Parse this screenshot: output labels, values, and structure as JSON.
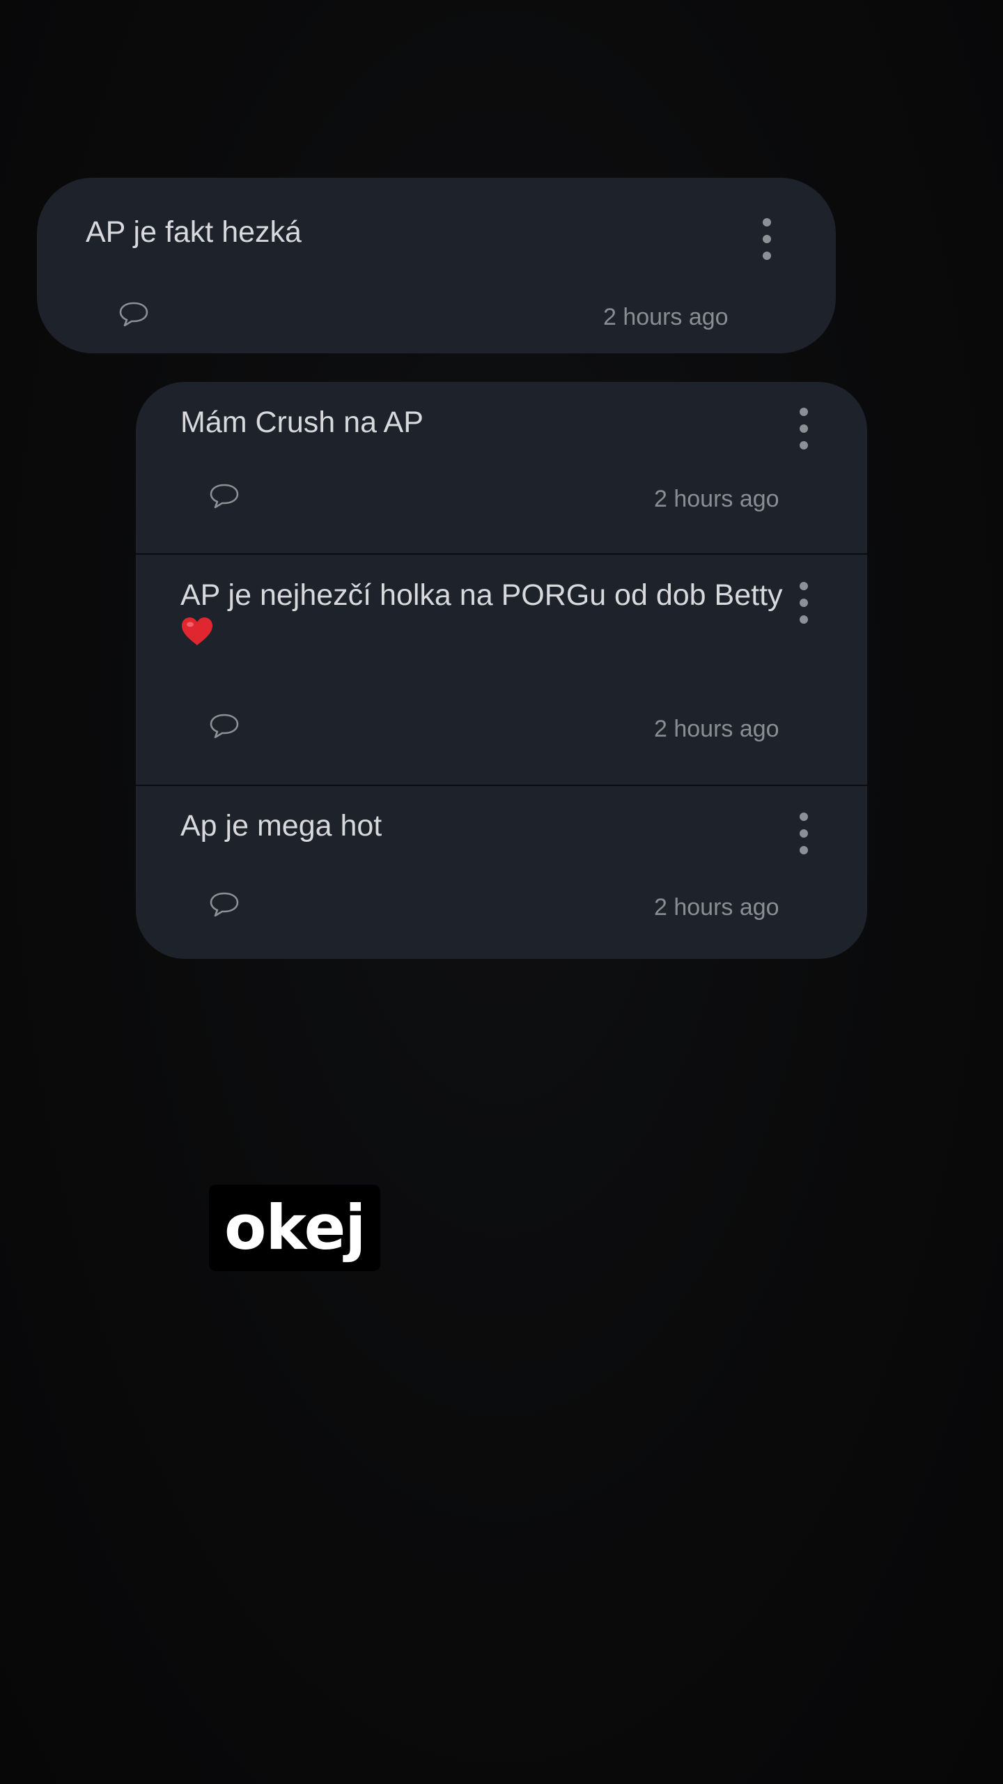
{
  "posts": [
    {
      "text": "AP je fakt hezká",
      "time": "2 hours ago"
    },
    {
      "text": "Mám Crush na AP",
      "time": "2 hours ago"
    },
    {
      "text": "AP je nejhezčí holka na PORGu od dob Betty",
      "time": "2 hours ago",
      "emoji": "red-heart-icon"
    },
    {
      "text": "Ap je mega hot",
      "time": "2 hours ago"
    }
  ],
  "sticker": {
    "text": "okej"
  },
  "colors": {
    "background": "#0a0a0b",
    "card": "#1d222b",
    "text": "#d7d9dc",
    "muted": "#8a8e94",
    "heart": "#e0262e"
  }
}
